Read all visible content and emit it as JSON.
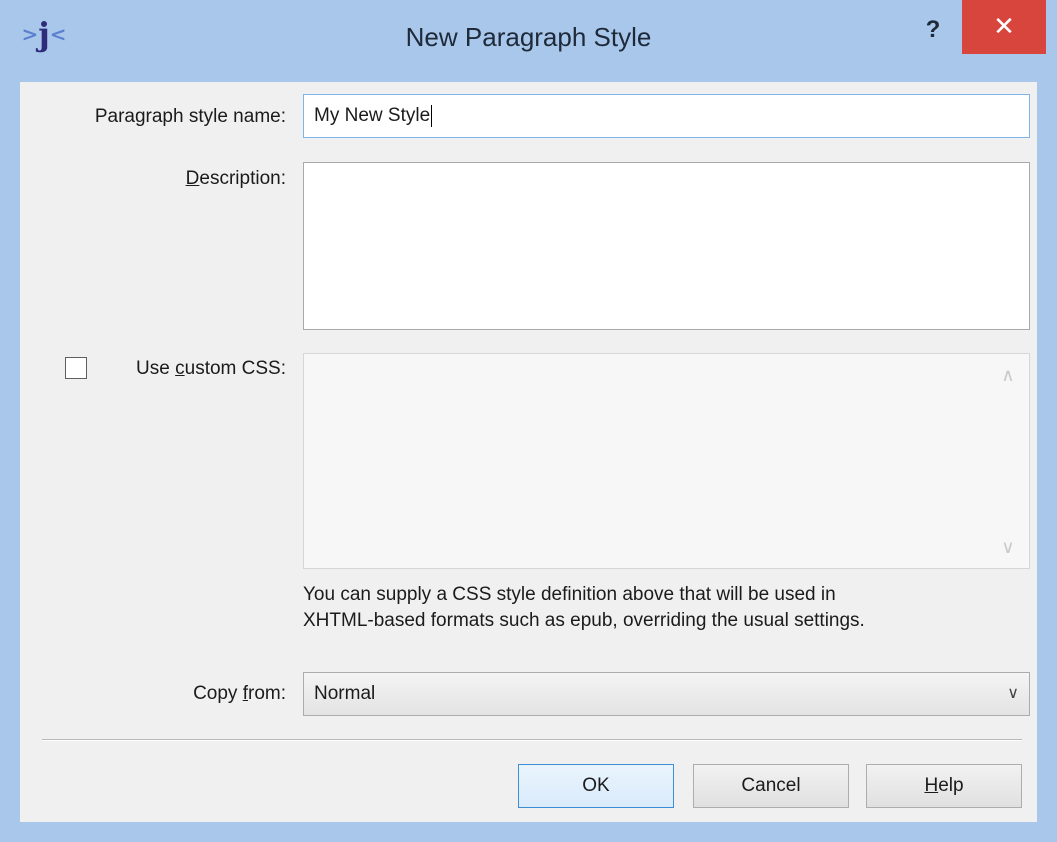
{
  "window": {
    "title": "New Paragraph Style",
    "app_icon": "jutoh-logo-icon",
    "help_button": "?",
    "close_button": "✕"
  },
  "form": {
    "name_label_pre": "Paragraph style name:",
    "name_value": "My New Style",
    "description_label_accel": "D",
    "description_label_rest": "escription:",
    "description_value": "",
    "custom_css_label_pre": "Use ",
    "custom_css_label_accel": "c",
    "custom_css_label_rest": "ustom CSS:",
    "custom_css_checked": false,
    "custom_css_value": "",
    "hint_line1": "You can supply a CSS style definition above that will be used in",
    "hint_line2": "XHTML-based formats such as epub, overriding the usual settings.",
    "copy_from_label_pre": "Copy ",
    "copy_from_label_accel": "f",
    "copy_from_label_rest": "rom:",
    "copy_from_value": "Normal"
  },
  "buttons": {
    "ok": "OK",
    "cancel": "Cancel",
    "help_accel": "H",
    "help_rest": "elp"
  },
  "colors": {
    "frame": "#a9c7ea",
    "close": "#d8453c",
    "focus_border": "#7fb4e6"
  }
}
